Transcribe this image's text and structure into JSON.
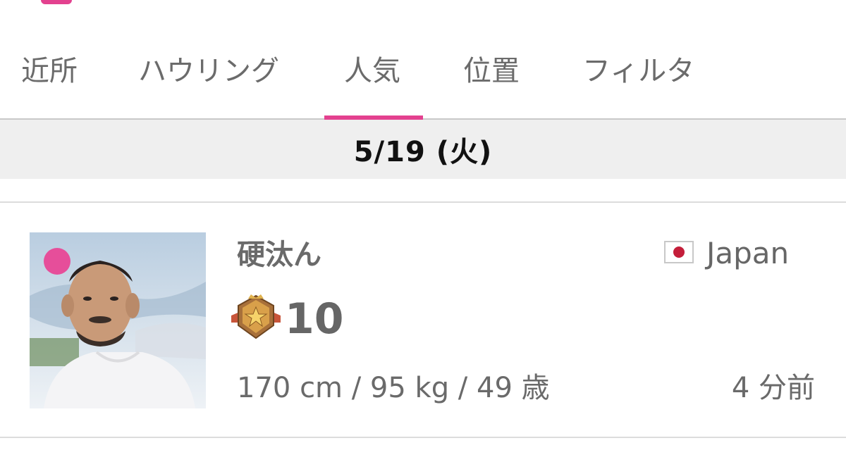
{
  "tabs": [
    {
      "label": "近所"
    },
    {
      "label": "ハウリング"
    },
    {
      "label": "人気",
      "active": true
    },
    {
      "label": "位置"
    },
    {
      "label": "フィルタ"
    }
  ],
  "accent_color": "#e3418f",
  "date_header": "5/19 (火)",
  "user": {
    "name": "硬汰ん",
    "online": true,
    "country": "Japan",
    "level": "10",
    "stats": "170 cm / 95 kg / 49 歳",
    "last_seen": "4 分前"
  }
}
